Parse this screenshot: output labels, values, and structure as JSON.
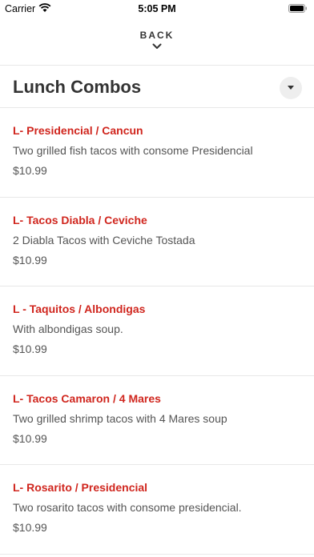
{
  "status": {
    "carrier": "Carrier",
    "time": "5:05 PM"
  },
  "nav": {
    "back_label": "BACK"
  },
  "section": {
    "title": "Lunch Combos"
  },
  "items": [
    {
      "name": "L- Presidencial / Cancun",
      "description": "Two grilled fish tacos with consome Presidencial",
      "price": "$10.99"
    },
    {
      "name": "L- Tacos Diabla / Ceviche",
      "description": "2 Diabla Tacos with Ceviche Tostada",
      "price": "$10.99"
    },
    {
      "name": "L - Taquitos / Albondigas",
      "description": "With albondigas soup.",
      "price": "$10.99"
    },
    {
      "name": "L- Tacos Camaron / 4 Mares",
      "description": "Two grilled shrimp tacos with 4 Mares soup",
      "price": "$10.99"
    },
    {
      "name": "L- Rosarito / Presidencial",
      "description": "Two rosarito tacos with consome presidencial.",
      "price": "$10.99"
    }
  ],
  "colors": {
    "item_name": "#d0261e",
    "divider": "#e8e8e8"
  }
}
